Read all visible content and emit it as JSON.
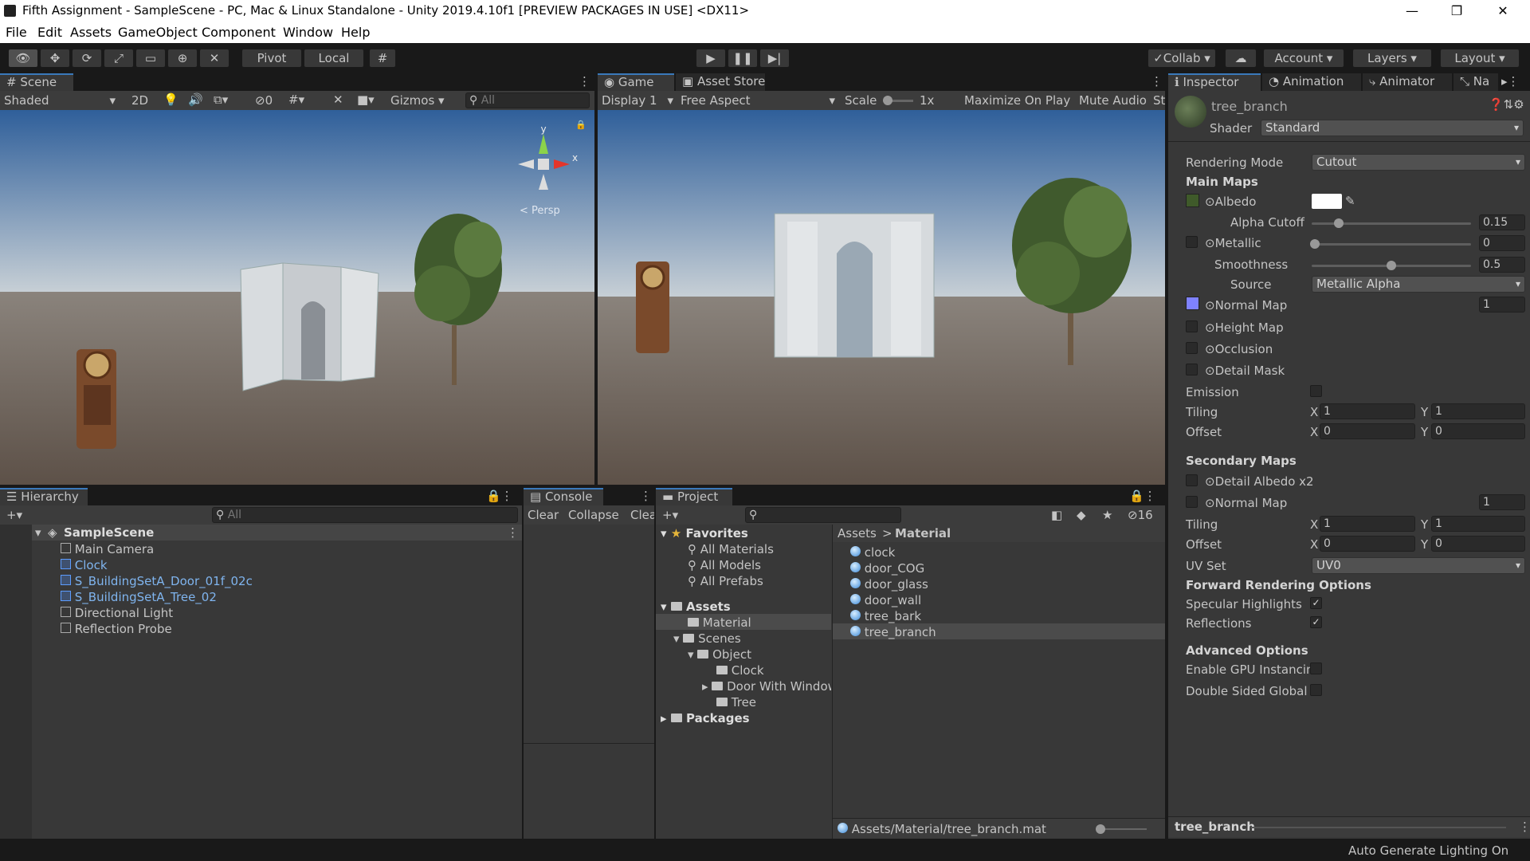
{
  "window": {
    "title": "Fifth Assignment - SampleScene - PC, Mac & Linux Standalone - Unity 2019.4.10f1 [PREVIEW PACKAGES IN USE] <DX11>",
    "minimize": "—",
    "maximize": "❐",
    "close": "✕"
  },
  "menu": [
    "File",
    "Edit",
    "Assets",
    "GameObject",
    "Component",
    "Window",
    "Help"
  ],
  "toolbar": {
    "pivot": "Pivot",
    "local": "Local",
    "collab": "Collab",
    "account": "Account",
    "layers": "Layers",
    "layout": "Layout"
  },
  "scene": {
    "tab": "Scene",
    "shading": "Shaded",
    "mode2d": "2D",
    "hidden_count": "0",
    "gizmos": "Gizmos",
    "search_placeholder": "All",
    "persp": "< Persp",
    "axis_x": "x",
    "axis_y": "y"
  },
  "game": {
    "tab": "Game",
    "asset_store_tab": "Asset Store",
    "display": "Display 1",
    "aspect": "Free Aspect",
    "scale_label": "Scale",
    "scale_value": "1x",
    "maximize": "Maximize On Play",
    "mute": "Mute Audio",
    "stats": "St"
  },
  "hierarchy": {
    "tab": "Hierarchy",
    "search_placeholder": "All",
    "scene": "SampleScene",
    "items": [
      {
        "name": "Main Camera",
        "prefab": false
      },
      {
        "name": "Clock",
        "prefab": true
      },
      {
        "name": "S_BuildingSetA_Door_01f_02c",
        "prefab": true
      },
      {
        "name": "S_BuildingSetA_Tree_02",
        "prefab": true
      },
      {
        "name": "Directional Light",
        "prefab": false
      },
      {
        "name": "Reflection Probe",
        "prefab": false
      }
    ]
  },
  "console": {
    "tab": "Console",
    "clear": "Clear",
    "collapse": "Collapse",
    "clear_on_play": "Clea"
  },
  "project": {
    "tab": "Project",
    "hidden_count": "16",
    "favorites": "Favorites",
    "fav_items": [
      "All Materials",
      "All Models",
      "All Prefabs"
    ],
    "assets": "Assets",
    "material": "Material",
    "scenes": "Scenes",
    "object": "Object",
    "clock": "Clock",
    "door": "Door With Window",
    "tree": "Tree",
    "packages": "Packages",
    "breadcrumb_root": "Assets",
    "breadcrumb_sep": ">",
    "breadcrumb_leaf": "Material",
    "files": [
      "clock",
      "door_COG",
      "door_glass",
      "door_wall",
      "tree_bark",
      "tree_branch"
    ],
    "status_path": "Assets/Material/tree_branch.mat"
  },
  "inspector": {
    "tabs": [
      "Inspector",
      "Animation",
      "Animator",
      "Na"
    ],
    "material_name": "tree_branch",
    "shader_label": "Shader",
    "shader": "Standard",
    "rendering_mode_label": "Rendering Mode",
    "rendering_mode": "Cutout",
    "main_maps": "Main Maps",
    "albedo": "Albedo",
    "alpha_cutoff": "Alpha Cutoff",
    "alpha_cutoff_value": "0.15",
    "alpha_cutoff_fraction": 0.15,
    "metallic": "Metallic",
    "metallic_value": "0",
    "smoothness": "Smoothness",
    "smoothness_value": "0.5",
    "smoothness_fraction": 0.5,
    "source_label": "Source",
    "source": "Metallic Alpha",
    "normal_map": "Normal Map",
    "normal_value": "1",
    "height_map": "Height Map",
    "occlusion": "Occlusion",
    "detail_mask": "Detail Mask",
    "emission": "Emission",
    "tiling": "Tiling",
    "offset": "Offset",
    "x": "X",
    "y": "Y",
    "tiling_x": "1",
    "tiling_y": "1",
    "offset_x": "0",
    "offset_y": "0",
    "secondary_maps": "Secondary Maps",
    "detail_albedo": "Detail Albedo x2",
    "sec_normal_map": "Normal Map",
    "sec_normal_value": "1",
    "sec_tiling_x": "1",
    "sec_tiling_y": "1",
    "sec_offset_x": "0",
    "sec_offset_y": "0",
    "uv_set_label": "UV Set",
    "uv_set": "UV0",
    "forward": "Forward Rendering Options",
    "specular": "Specular Highlights",
    "reflections": "Reflections",
    "advanced": "Advanced Options",
    "gpu_instancing": "Enable GPU Instancin",
    "double_sided": "Double Sided Global I",
    "preview_name": "tree_branch"
  },
  "statusbar": {
    "text": "Auto Generate Lighting On"
  },
  "colors": {
    "accent": "#3a79bb",
    "prefab": "#7fb4ee",
    "panel": "#383838"
  }
}
